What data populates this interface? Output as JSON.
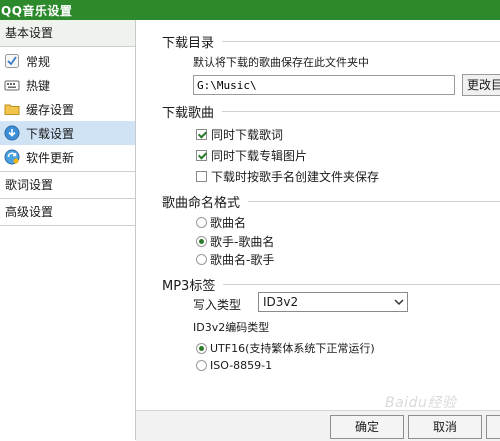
{
  "window": {
    "title": "QQ音乐设置"
  },
  "sidebar": {
    "top_group": "基本设置",
    "items": [
      {
        "label": "常规",
        "icon": "settings-icon"
      },
      {
        "label": "热键",
        "icon": "keyboard-icon"
      },
      {
        "label": "缓存设置",
        "icon": "folder-icon"
      },
      {
        "label": "下载设置",
        "icon": "download-icon"
      },
      {
        "label": "软件更新",
        "icon": "update-icon"
      }
    ],
    "groups": [
      "歌词设置",
      "高级设置"
    ]
  },
  "download_dir": {
    "title": "下载目录",
    "desc": "默认将下载的歌曲保存在此文件夹中",
    "path": "G:\\Music\\",
    "change_label": "更改目"
  },
  "download_songs": {
    "title": "下载歌曲",
    "options": [
      {
        "label": "同时下载歌词",
        "checked": true
      },
      {
        "label": "同时下载专辑图片",
        "checked": true
      },
      {
        "label": "下载时按歌手名创建文件夹保存",
        "checked": false
      }
    ]
  },
  "naming": {
    "title": "歌曲命名格式",
    "options": [
      {
        "label": "歌曲名",
        "selected": false
      },
      {
        "label": "歌手-歌曲名",
        "selected": true
      },
      {
        "label": "歌曲名-歌手",
        "selected": false
      }
    ]
  },
  "mp3_tags": {
    "title": "MP3标签",
    "write_type_label": "写入类型",
    "write_type_value": "ID3v2",
    "encoding_label": "ID3v2编码类型",
    "encodings": [
      {
        "label": "UTF16(支持繁体系统下正常运行)",
        "selected": true
      },
      {
        "label": "ISO-8859-1",
        "selected": false
      }
    ]
  },
  "footer": {
    "ok_label": "确定",
    "cancel_label": "取消",
    "extra_label": ""
  },
  "watermark": "Baidu经验",
  "colors": {
    "titlebar": "#2c8a2c",
    "selected_item": "#cfe3f5",
    "check": "#2a7a2a"
  }
}
